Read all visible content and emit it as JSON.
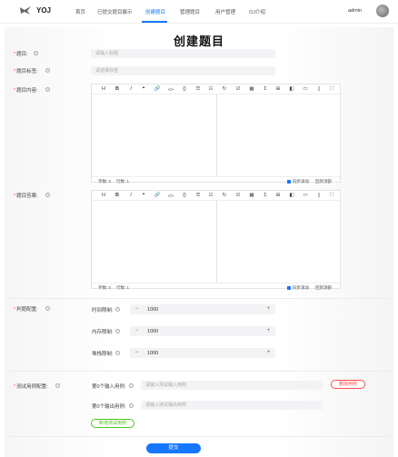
{
  "nav": {
    "brand": "YOJ",
    "items": [
      "首页",
      "已提交题目展示",
      "创建题目",
      "管理题目",
      "用户管理",
      "OJ介绍"
    ],
    "active_index": 2,
    "username": "admin"
  },
  "page": {
    "title": "创建题目"
  },
  "form": {
    "title_label": "题目:",
    "title_placeholder": "请输入标题",
    "tags_label": "题目标签:",
    "tags_placeholder": "请选择标签",
    "content_label": "题目内容:",
    "answer_label": "题目答案:",
    "editor": {
      "toolbar": [
        "H",
        "B",
        "I",
        "❝",
        "🔗",
        "</>",
        "{}",
        "☰",
        "☷",
        "↻",
        "☑",
        "▦",
        "Σ",
        "⊞",
        "◧",
        "▭",
        "▯",
        "⛶"
      ],
      "word_count": "字数: 0",
      "line_count": "行数: 1",
      "sync_scroll": "同步滚动",
      "back_to_top": "回到顶部"
    },
    "judge_config_label": "判题配置:",
    "limits": [
      {
        "label": "时间限制:",
        "value": "1000"
      },
      {
        "label": "内存限制:",
        "value": "1000"
      },
      {
        "label": "堆栈限制:",
        "value": "1000"
      }
    ],
    "minus": "−",
    "plus": "+",
    "cases_label": "测试用例配置:",
    "case_input_label": "第0个输入用例:",
    "case_input_placeholder": "请输入测试输入用例",
    "case_output_label": "第0个输出用例:",
    "case_output_placeholder": "请输入测试输出用例",
    "delete_case": "删除用例",
    "add_case": "新增测试用例",
    "submit": "提交"
  },
  "colors": {
    "accent": "#1677ff",
    "danger": "#ff4d4f",
    "success": "#52c41a"
  }
}
